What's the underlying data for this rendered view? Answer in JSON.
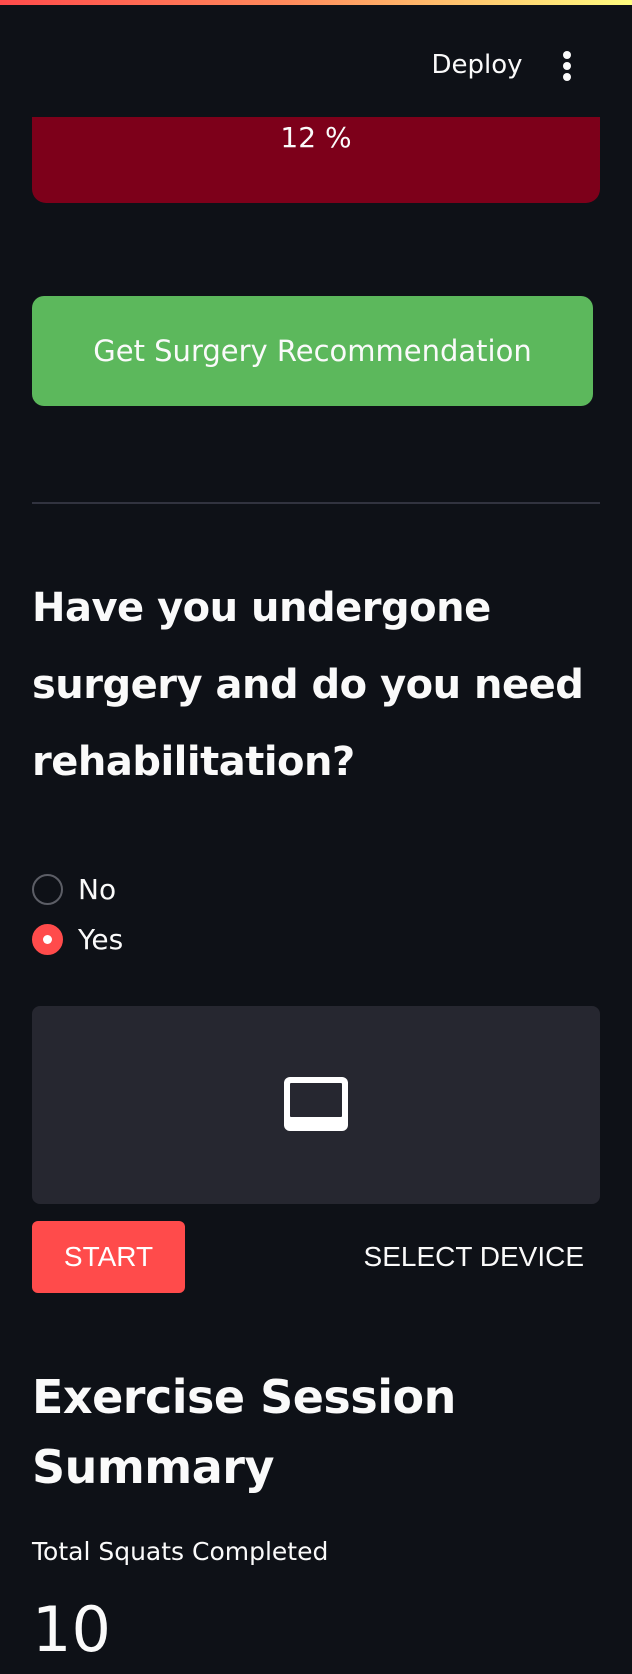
{
  "header": {
    "deploy_label": "Deploy",
    "menu_icon": "vertical-ellipsis-icon"
  },
  "risk": {
    "text": "12 %",
    "color": "#7d001a"
  },
  "recommendation": {
    "button_label": "Get Surgery Recommendation",
    "color": "#5cb85c"
  },
  "rehab": {
    "question": "Have you undergone surgery and do you need rehabilitation?",
    "options": [
      {
        "label": "No",
        "selected": false
      },
      {
        "label": "Yes",
        "selected": true
      }
    ]
  },
  "webcam": {
    "icon": "monitor-icon",
    "start_label": "START",
    "select_device_label": "SELECT DEVICE"
  },
  "summary": {
    "title": "Exercise Session Summary",
    "metric_label": "Total Squats Completed",
    "metric_value": "10"
  },
  "colors": {
    "background": "#0e1117",
    "accent": "#ff4b4b",
    "panel": "#262730"
  }
}
